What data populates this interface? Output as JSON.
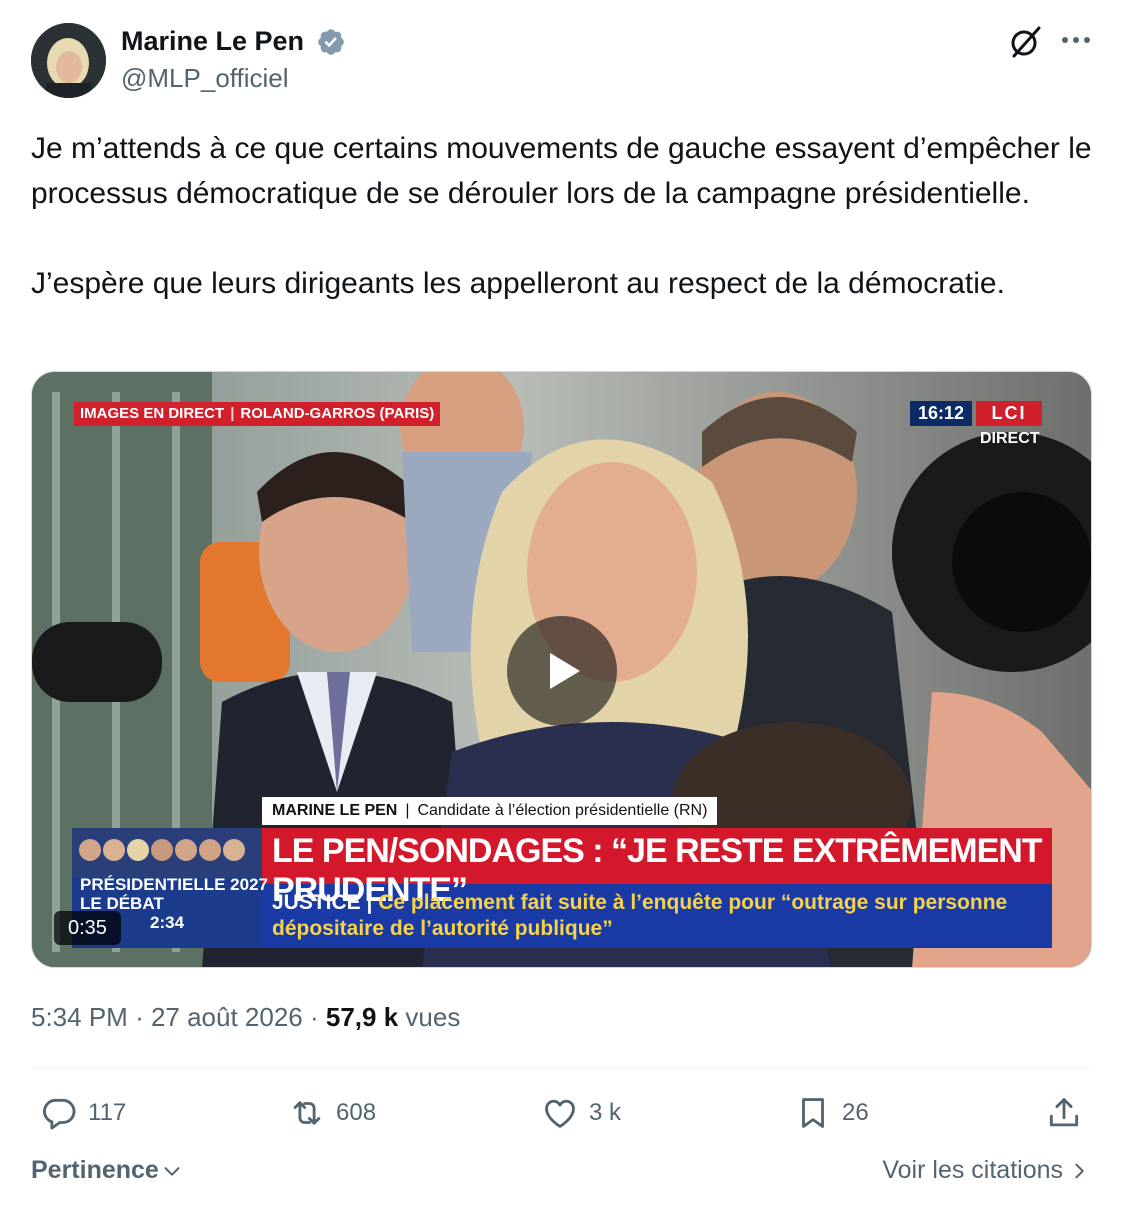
{
  "author": {
    "name": "Marine Le Pen",
    "handle": "@MLP_officiel",
    "verified_color": "#829aab"
  },
  "tweet": {
    "text": "Je m’attends à ce que certains mouvements de gauche essayent d’empêcher le processus démocratique de se dérouler lors de la campagne présidentielle.\n\nJ’espère que leurs dirigeants les appelleront au respect de la démocratie."
  },
  "video": {
    "live_label": "IMAGES EN DIRECT",
    "location_label": "ROLAND-GARROS (PARIS)",
    "clock": "16:12",
    "channel": "LCI",
    "direct": "DIRECT",
    "nameplate_name": "MARINE LE PEN",
    "nameplate_role": "Candidate à l’élection présidentielle (RN)",
    "headline": "LE PEN/SONDAGES : “JE RESTE EXTRÊMEMENT PRUDENTE”",
    "sub_label": "JUSTICE",
    "sub_text": "Ce placement fait suite à l’enquête pour “outrage sur personne dépositaire de l’autorité publique”",
    "program_line1": "PRÉSIDENTIELLE 2027",
    "program_line2": "LE DÉBAT",
    "program_time": "2:34",
    "duration": "0:35"
  },
  "meta": {
    "time": "5:34 PM",
    "date": "27 août 2026",
    "views_count": "57,9 k",
    "views_label": "vues"
  },
  "actions": {
    "replies": "117",
    "reposts": "608",
    "likes": "3 k",
    "bookmarks": "26"
  },
  "footer": {
    "sort_label": "Pertinence",
    "quotes_label": "Voir les citations"
  },
  "colors": {
    "text_primary": "#0f1419",
    "text_secondary": "#536471",
    "lci_red": "#d0202c",
    "lci_blue": "#1a3aa5"
  }
}
